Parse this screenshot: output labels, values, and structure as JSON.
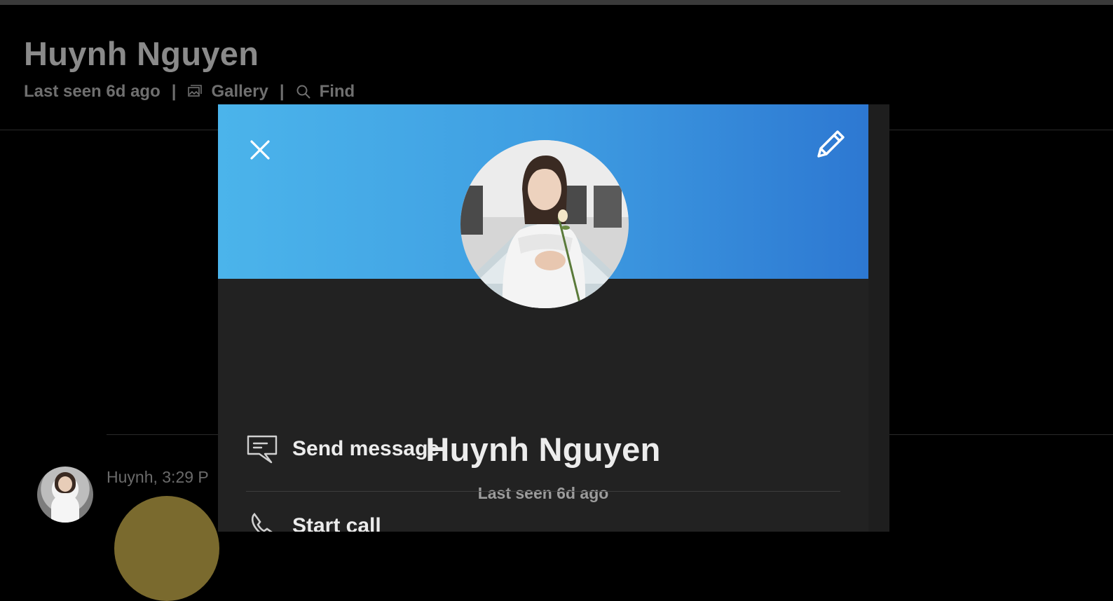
{
  "chat_header": {
    "name": "Huynh Nguyen",
    "status": "Last seen 6d ago",
    "separator": "|",
    "gallery_label": "Gallery",
    "find_label": "Find"
  },
  "chat_message": {
    "sender_time": "Huynh, 3:29 P"
  },
  "profile": {
    "name": "Huynh Nguyen",
    "status": "Last seen 6d ago",
    "actions": [
      {
        "label": "Send message",
        "icon": "chat-bubble-icon"
      },
      {
        "label": "Start call",
        "icon": "phone-icon"
      }
    ]
  },
  "colors": {
    "banner_start": "#4bb4eb",
    "banner_end": "#2d78d2",
    "modal_bg": "#222222",
    "app_bg": "#000000"
  }
}
